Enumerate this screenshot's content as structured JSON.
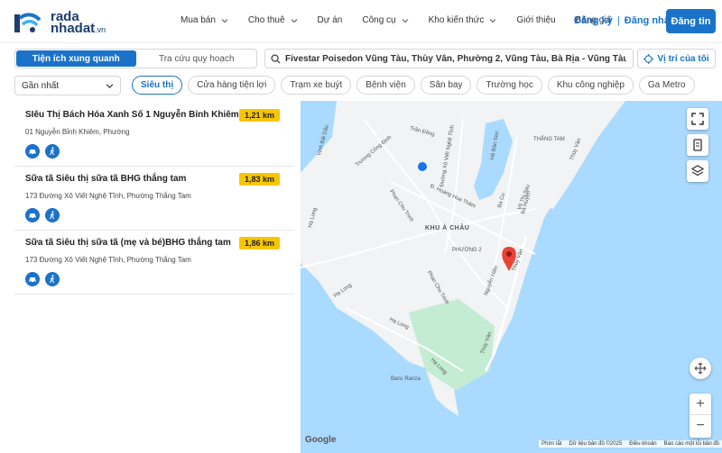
{
  "logo": {
    "line1": "rada",
    "line2": "nhadat",
    "suffix": ".vn"
  },
  "nav": [
    {
      "label": "Mua bán",
      "has_dropdown": true
    },
    {
      "label": "Cho thuê",
      "has_dropdown": true
    },
    {
      "label": "Dự án",
      "has_dropdown": false
    },
    {
      "label": "Công cụ",
      "has_dropdown": true
    },
    {
      "label": "Kho kiến thức",
      "has_dropdown": true
    },
    {
      "label": "Giới thiệu",
      "has_dropdown": false
    },
    {
      "label": "Bảng giá",
      "has_dropdown": false
    }
  ],
  "auth": {
    "register": "Đăng ký",
    "separator": "|",
    "login": "Đăng nhập"
  },
  "post_button": "Đăng tin",
  "tabs": [
    {
      "label": "Tiện ích xung quanh",
      "active": true
    },
    {
      "label": "Tra cứu quy hoạch",
      "active": false
    }
  ],
  "search": {
    "value": "Fivestar Poisedon Vũng Tàu, Thùy Vân, Phường 2, Vũng Tàu, Bà Rịa - Vũng Tàu, Việt Nam"
  },
  "locate_button": "Vị trí của tôi",
  "sort_select": {
    "selected": "Gần nhất"
  },
  "chips": [
    {
      "label": "Siêu thị",
      "active": true
    },
    {
      "label": "Cửa hàng tiện lợi",
      "active": false
    },
    {
      "label": "Trạm xe buýt",
      "active": false
    },
    {
      "label": "Bệnh viện",
      "active": false
    },
    {
      "label": "Sân bay",
      "active": false
    },
    {
      "label": "Trường học",
      "active": false
    },
    {
      "label": "Khu công nghiệp",
      "active": false
    },
    {
      "label": "Ga Metro",
      "active": false
    }
  ],
  "results": [
    {
      "name": "SIêu Thị Bách Hóa Xanh Số 1 Nguyễn Bỉnh Khiêm",
      "address": "01 Nguyễn Bỉnh Khiêm, Phường",
      "distance": "1,21 km"
    },
    {
      "name": "Sữa tã Siêu thị sữa tã BHG thắng tam",
      "address": "173 Đường Xô Viết Nghệ Tĩnh, Phường Thắng Tam",
      "distance": "1,83 km"
    },
    {
      "name": "Sữa tã Siêu thị sữa tã (mẹ và bé)BHG thắng tam",
      "address": "173 Đường Xô Viết Nghệ Tĩnh, Phường Thắng Tam",
      "distance": "1,86 km"
    }
  ],
  "map": {
    "labels": {
      "khu_a_chau": "KHU Á CHÂU",
      "phuong2": "PHƯỜNG 2",
      "thang_tam": "THẮNG TAM",
      "ho_ban_sen": "Hồ Bàn Sen",
      "bai_dau": "Vịnh Bãi Dâu",
      "ha_long": "Hạ Long",
      "thuy_van": "Thùy Vân",
      "hoang_hoa_tham": "Đ. Hoàng Hoa Thám",
      "xo_viet": "Đường Xô Viết Nghệ Tĩnh",
      "truong_cong_dinh": "Trương Công Định",
      "tran_dong": "Trần Đồng",
      "phan_chu_trinh": "Phan Chu Trinh",
      "nguyen_hien": "Nguyễn Hiền",
      "vo_thi_sau": "Võ Thị Sáu",
      "ba_cu": "Ba Cu",
      "ba_huyen": "Bà Huyện",
      "banc_ranza": "Banc Ranza"
    },
    "google": "Google",
    "attribution": [
      "Phím tắt",
      "Dữ liệu bản đồ ©2025",
      "Điều khoản",
      "Báo cáo một lỗi bản đồ"
    ],
    "colors": {
      "water": "#aadaff",
      "land": "#f1f3f4",
      "park": "#c3ecd2",
      "marker": "#ea4335"
    }
  }
}
